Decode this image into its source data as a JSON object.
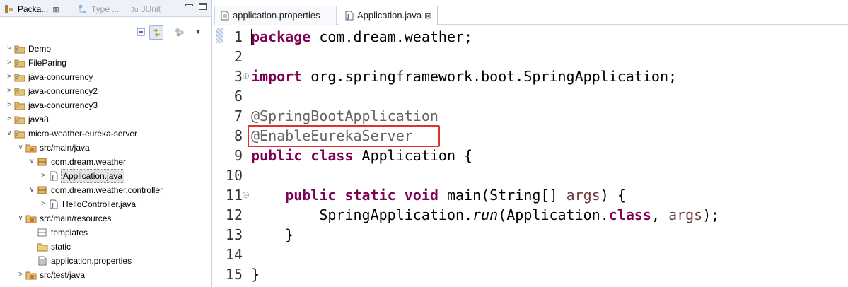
{
  "explorer": {
    "tabs": [
      {
        "label": "Packa...",
        "close": "⊠",
        "active": true
      },
      {
        "label": "Type ...",
        "active": false
      },
      {
        "label": "JUnit",
        "prefix": "Ju",
        "active": false
      }
    ],
    "toolbar_menu": "▼",
    "tree": [
      {
        "label": "Demo",
        "level": 0,
        "arrow": ">",
        "icon": "project-icon"
      },
      {
        "label": "FileParing",
        "level": 0,
        "arrow": ">",
        "icon": "project-icon"
      },
      {
        "label": "java-concurrency",
        "level": 0,
        "arrow": ">",
        "icon": "project-icon"
      },
      {
        "label": "java-concurrency2",
        "level": 0,
        "arrow": ">",
        "icon": "project-icon"
      },
      {
        "label": "java-concurrency3",
        "level": 0,
        "arrow": ">",
        "icon": "project-icon"
      },
      {
        "label": "java8",
        "level": 0,
        "arrow": ">",
        "icon": "project-icon"
      },
      {
        "label": "micro-weather-eureka-server",
        "level": 0,
        "arrow": "∨",
        "icon": "project-icon"
      },
      {
        "label": "src/main/java",
        "level": 1,
        "arrow": "∨",
        "icon": "source-folder-icon"
      },
      {
        "label": "com.dream.weather",
        "level": 2,
        "arrow": "∨",
        "icon": "package-icon"
      },
      {
        "label": "Application.java",
        "level": 3,
        "arrow": ">",
        "icon": "java-file-icon",
        "selected": true
      },
      {
        "label": "com.dream.weather.controller",
        "level": 2,
        "arrow": "∨",
        "icon": "package-icon"
      },
      {
        "label": "HelloController.java",
        "level": 3,
        "arrow": ">",
        "icon": "java-file-icon"
      },
      {
        "label": "src/main/resources",
        "level": 1,
        "arrow": "∨",
        "icon": "source-folder-icon"
      },
      {
        "label": "templates",
        "level": 2,
        "arrow": "",
        "icon": "empty-package-icon"
      },
      {
        "label": "static",
        "level": 2,
        "arrow": "",
        "icon": "folder-icon"
      },
      {
        "label": "application.properties",
        "level": 2,
        "arrow": "",
        "icon": "properties-file-icon"
      },
      {
        "label": "src/test/java",
        "level": 1,
        "arrow": ">",
        "icon": "source-folder-icon"
      }
    ]
  },
  "editor": {
    "tabs": [
      {
        "label": "application.properties",
        "active": false
      },
      {
        "label": "Application.java",
        "close": "⊠",
        "active": true
      }
    ],
    "lines": [
      {
        "num": "1",
        "tokens": [
          {
            "t": "package",
            "c": "kw"
          },
          {
            "t": " com.dream.weather;"
          }
        ]
      },
      {
        "num": "2",
        "tokens": []
      },
      {
        "num": "3",
        "fold": "+",
        "tokens": [
          {
            "t": "import",
            "c": "kw"
          },
          {
            "t": " org.springframework.boot.SpringApplication;"
          }
        ]
      },
      {
        "num": "6",
        "tokens": []
      },
      {
        "num": "7",
        "tokens": [
          {
            "t": "@SpringBootApplication",
            "c": "ann"
          }
        ]
      },
      {
        "num": "8",
        "tokens": [
          {
            "t": "@EnableEurekaServer",
            "c": "ann"
          }
        ]
      },
      {
        "num": "9",
        "tokens": [
          {
            "t": "public",
            "c": "kw"
          },
          {
            "t": " "
          },
          {
            "t": "class",
            "c": "kw"
          },
          {
            "t": " Application {"
          }
        ]
      },
      {
        "num": "10",
        "tokens": []
      },
      {
        "num": "11",
        "fold": "−",
        "tokens": [
          {
            "t": "    "
          },
          {
            "t": "public",
            "c": "kw"
          },
          {
            "t": " "
          },
          {
            "t": "static",
            "c": "kw"
          },
          {
            "t": " "
          },
          {
            "t": "void",
            "c": "kw"
          },
          {
            "t": " main(String[] "
          },
          {
            "t": "args",
            "c": "param"
          },
          {
            "t": ") {"
          }
        ]
      },
      {
        "num": "12",
        "tokens": [
          {
            "t": "        SpringApplication."
          },
          {
            "t": "run",
            "c": "it"
          },
          {
            "t": "(Application."
          },
          {
            "t": "class",
            "c": "kw"
          },
          {
            "t": ", "
          },
          {
            "t": "args",
            "c": "param"
          },
          {
            "t": ");"
          }
        ]
      },
      {
        "num": "13",
        "tokens": [
          {
            "t": "    }"
          }
        ]
      },
      {
        "num": "14",
        "tokens": []
      },
      {
        "num": "15",
        "tokens": [
          {
            "t": "}"
          }
        ]
      }
    ]
  },
  "colors": {
    "keyword": "#7f0055",
    "annotation": "#646464",
    "parameter": "#6a3e3e",
    "highlight_box": "#e03030",
    "tab_bar_bg": "#eef2f8"
  }
}
